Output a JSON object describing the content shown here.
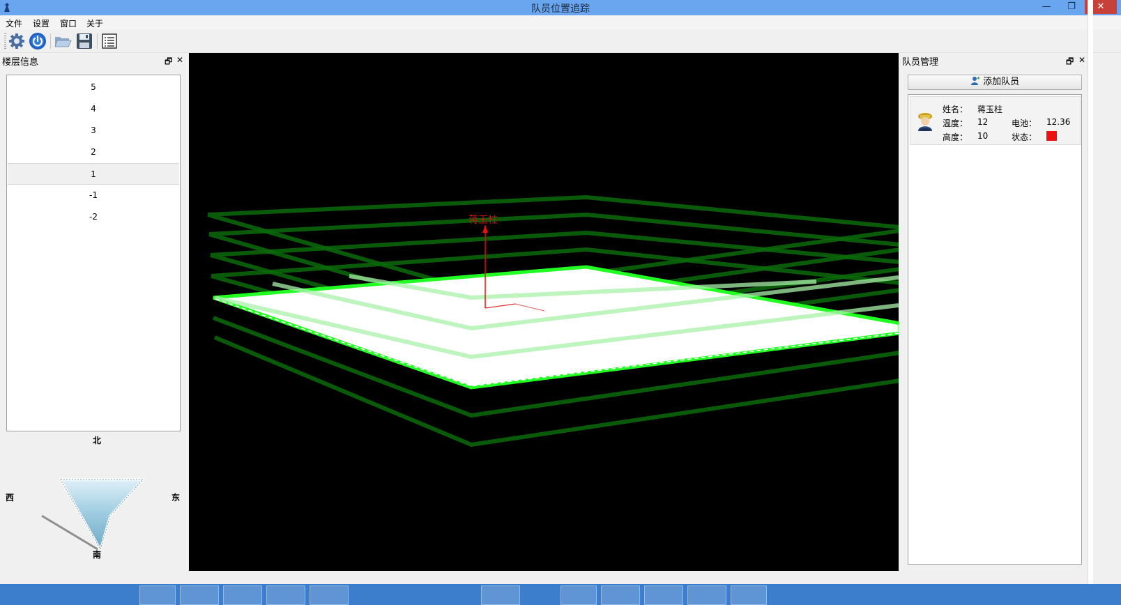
{
  "window": {
    "title": "队员位置追踪",
    "minimize": "—",
    "maximize": "❐",
    "close": "✕"
  },
  "menu": {
    "items": [
      "文件",
      "设置",
      "窗口",
      "关于"
    ]
  },
  "toolbar": {
    "buttons": [
      "settings-icon",
      "power-icon",
      "folder-open-icon",
      "save-icon",
      "list-icon"
    ]
  },
  "floor_panel": {
    "title": "楼层信息",
    "float_btn": "🗗",
    "close_btn": "✕",
    "floors": [
      "5",
      "4",
      "3",
      "2",
      "1",
      "-1",
      "-2"
    ],
    "selected": "1"
  },
  "compass": {
    "north": "北",
    "west": "西",
    "east": "东",
    "south": "南"
  },
  "scene": {
    "member_label": "蒋玉柱",
    "active_floor_color": "#00ff00",
    "inactive_floor_color": "#0a5a0a"
  },
  "member_panel": {
    "title": "队员管理",
    "float_btn": "🗗",
    "close_btn": "✕",
    "add_button": "添加队员",
    "members": [
      {
        "name_label": "姓名：",
        "name": "蒋玉柱",
        "temp_label": "温度：",
        "temp": "12",
        "battery_label": "电池：",
        "battery": "12.36",
        "height_label": "高度：",
        "height": "10",
        "status_label": "状态：",
        "status_color": "#ee1111"
      }
    ]
  }
}
